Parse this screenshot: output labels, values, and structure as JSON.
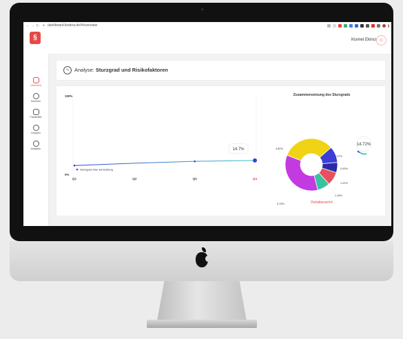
{
  "browser": {
    "url": "dashboard.lindera.de/#/overview"
  },
  "app": {
    "logo_glyph": "§",
    "user_name": "Kismet Ekinci",
    "sidebar": [
      {
        "label": "Übersicht",
        "active": true,
        "icon": "home-icon"
      },
      {
        "label": "Senioren",
        "active": false,
        "icon": "people-icon"
      },
      {
        "label": "Fachkräfte",
        "active": false,
        "icon": "caregiver-icon"
      },
      {
        "label": "Gruppen",
        "active": false,
        "icon": "group-icon"
      },
      {
        "label": "Analysen",
        "active": false,
        "icon": "analysis-icon"
      }
    ]
  },
  "analysis": {
    "title_prefix": "Analyse: ",
    "title_bold": "Sturzgrad und Risikofaktoren"
  },
  "chart_data": [
    {
      "type": "line",
      "x": [
        "Q1",
        "Q2",
        "Q3",
        "Q4"
      ],
      "y_tick_labels": [
        "100%",
        "0%"
      ],
      "ylim": [
        0,
        100
      ],
      "series": [
        {
          "name": "Sturzgrad Ihrer Einrichtung",
          "values": [
            8,
            11,
            13.5,
            14.7
          ]
        }
      ],
      "highlight_x": "Q4",
      "callout": "14.7%",
      "colors": {
        "line_start": "#3b3fd6",
        "line_end": "#39c2c6",
        "highlight": "#e84848"
      }
    },
    {
      "type": "pie",
      "title": "Zusammensetzung des Sturzgrads",
      "total_label": "14.72%",
      "slices": [
        {
          "label": "4.82%",
          "value": 4.82,
          "color": "#f1d316"
        },
        {
          "label": "1.47%",
          "value": 1.47,
          "color": "#3b3fd6"
        },
        {
          "label": "0.93%",
          "value": 0.93,
          "color": "#2a2aa8"
        },
        {
          "label": "1.22%",
          "value": 1.22,
          "color": "#e8505b"
        },
        {
          "label": "1.15%",
          "value": 1.15,
          "color": "#39c2a0"
        },
        {
          "label": "5.13%",
          "value": 5.13,
          "color": "#c23ae0"
        }
      ],
      "link": "Detailansicht"
    }
  ]
}
